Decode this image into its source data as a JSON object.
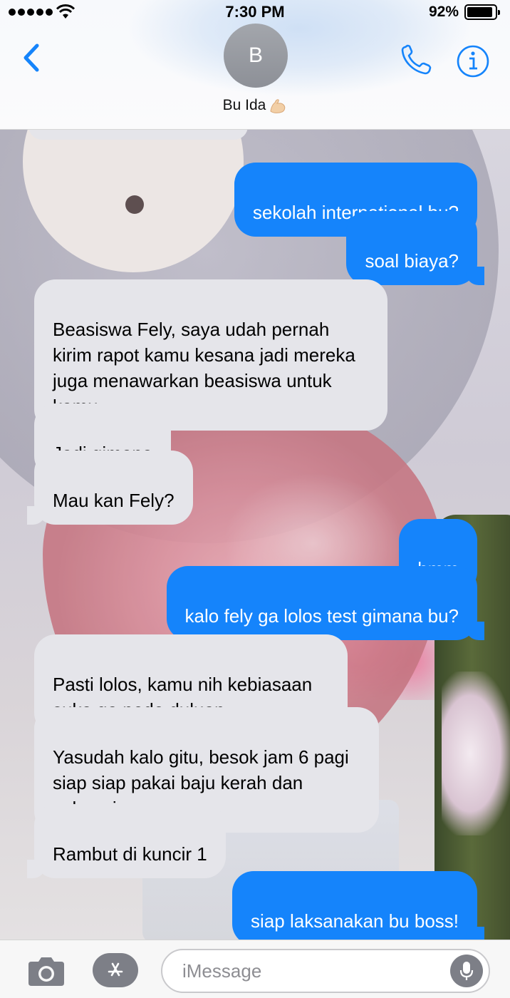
{
  "status_bar": {
    "time": "7:30 PM",
    "battery_percent": "92%",
    "battery_level": 0.92,
    "signal_bars": 5
  },
  "header": {
    "avatar_initial": "B",
    "contact_name": "Bu Ida",
    "name_emoji_icon": "flexed-biceps-icon",
    "back_icon": "chevron-left-icon",
    "call_icon": "phone-icon",
    "info_icon": "info-icon"
  },
  "messages": [
    {
      "direction": "outgoing",
      "text": "sekolah international bu?"
    },
    {
      "direction": "outgoing",
      "text": "soal biaya?"
    },
    {
      "direction": "incoming",
      "text": "Beasiswa Fely, saya udah pernah kirim rapot kamu kesana jadi mereka juga menawarkan beasiswa untuk kamu"
    },
    {
      "direction": "incoming",
      "text": "Jadi gimana"
    },
    {
      "direction": "incoming",
      "text": "Mau kan Fely?"
    },
    {
      "direction": "outgoing",
      "text": "hmm"
    },
    {
      "direction": "outgoing",
      "text": "kalo fely ga lolos test gimana bu?"
    },
    {
      "direction": "incoming",
      "text": "Pasti lolos, kamu nih kebiasaan suka ga pede duluan"
    },
    {
      "direction": "incoming",
      "text": "Yasudah kalo gitu, besok jam 6 pagi siap siap pakai baju kerah dan celana jeans ya"
    },
    {
      "direction": "incoming",
      "text": "Rambut di kuncir 1"
    },
    {
      "direction": "outgoing",
      "text": "siap laksanakan bu boss!"
    }
  ],
  "composer": {
    "placeholder": "iMessage",
    "value": "",
    "camera_icon": "camera-icon",
    "appstore_icon": "app-store-icon",
    "mic_icon": "microphone-icon"
  },
  "colors": {
    "accent": "#1584fb",
    "incoming_bubble": "#e5e5ea",
    "avatar": "#9a9da3"
  }
}
